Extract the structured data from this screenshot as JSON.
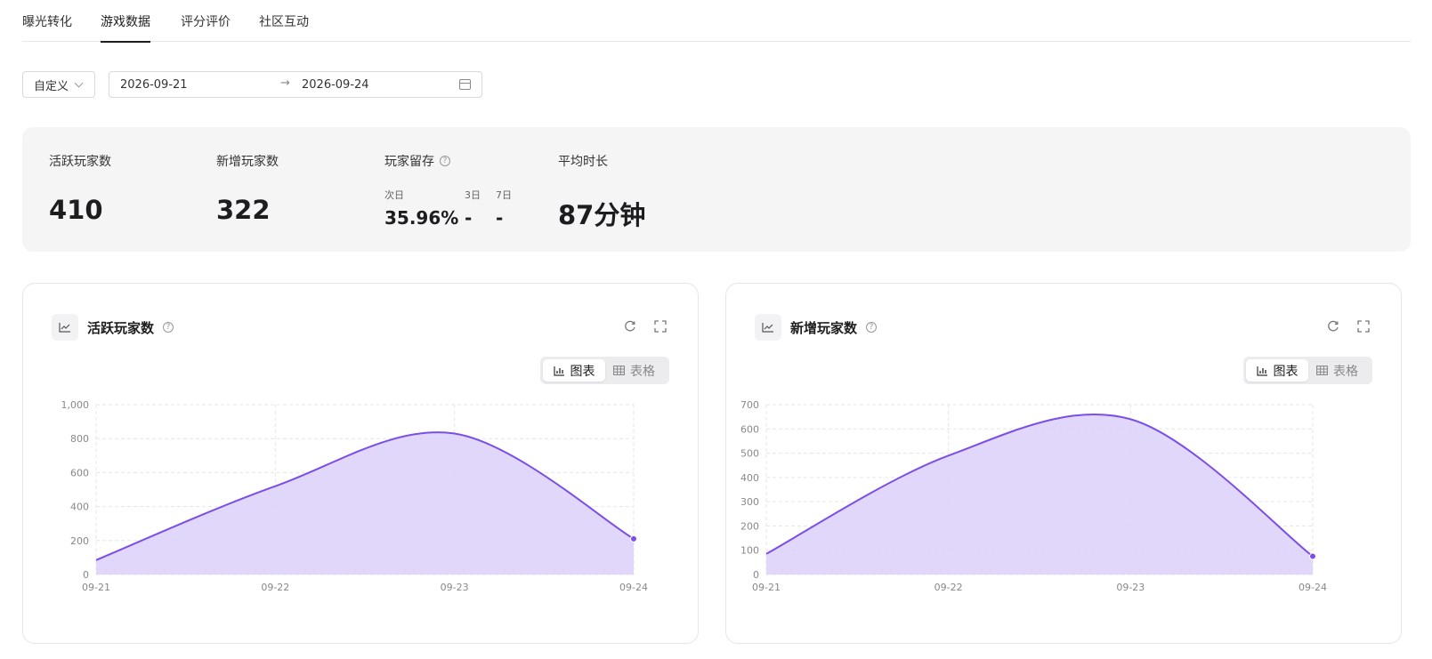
{
  "tabs": [
    "曝光转化",
    "游戏数据",
    "评分评价",
    "社区互动"
  ],
  "active_tab": "游戏数据",
  "filter": {
    "range_type": "自定义",
    "start_date": "2026-09-21",
    "end_date": "2026-09-24"
  },
  "stats": {
    "active_players": {
      "label": "活跃玩家数",
      "value": "410"
    },
    "new_players": {
      "label": "新增玩家数",
      "value": "322"
    },
    "retention": {
      "label": "玩家留存",
      "day1_label": "次日",
      "day1_value": "35.96%",
      "day3_label": "3日",
      "day3_value": "-",
      "day7_label": "7日",
      "day7_value": "-"
    },
    "avg_duration": {
      "label": "平均时长",
      "value": "87分钟"
    }
  },
  "view_toggle": {
    "chart_label": "图表",
    "table_label": "表格"
  },
  "colors": {
    "line": "#7b4ee8",
    "fill": "#ddd3fb"
  },
  "chart_data": [
    {
      "type": "area",
      "title": "活跃玩家数",
      "x": [
        "09-21",
        "09-22",
        "09-23",
        "09-24"
      ],
      "values": [
        85,
        520,
        830,
        210
      ],
      "yticks": [
        0,
        200,
        400,
        600,
        800,
        1000
      ],
      "ytick_labels": [
        "0",
        "200",
        "400",
        "600",
        "800",
        "1,000"
      ],
      "ylim": [
        0,
        1000
      ],
      "grid": true
    },
    {
      "type": "area",
      "title": "新增玩家数",
      "x": [
        "09-21",
        "09-22",
        "09-23",
        "09-24"
      ],
      "values": [
        85,
        490,
        640,
        75
      ],
      "yticks": [
        0,
        100,
        200,
        300,
        400,
        500,
        600,
        700
      ],
      "ytick_labels": [
        "0",
        "100",
        "200",
        "300",
        "400",
        "500",
        "600",
        "700"
      ],
      "ylim": [
        0,
        700
      ],
      "grid": true
    }
  ]
}
